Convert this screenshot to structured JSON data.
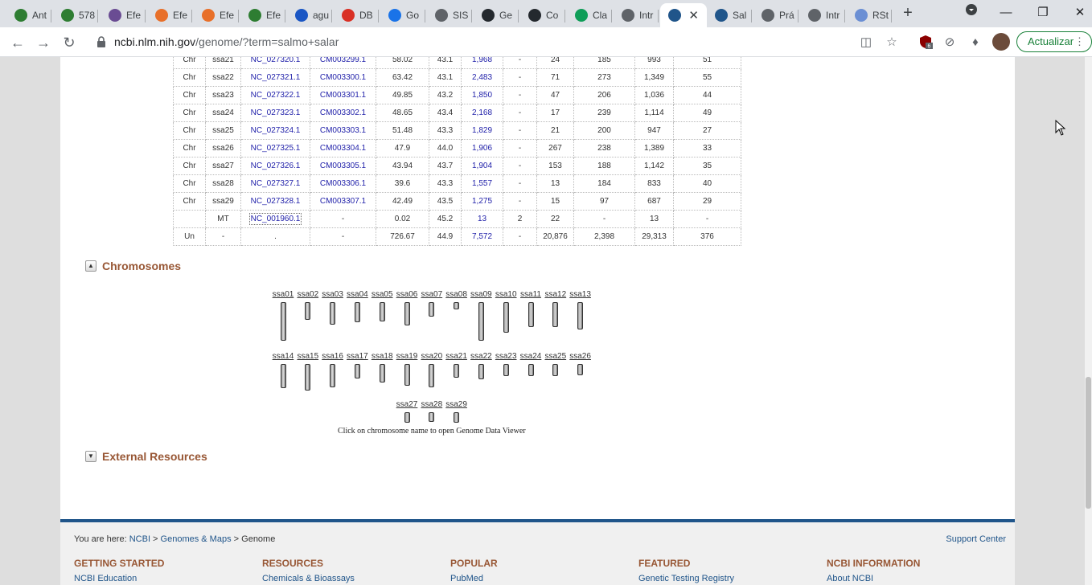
{
  "browser": {
    "tabs": [
      {
        "label": "Ant",
        "icon": "ncbi-icon",
        "color": "#2e7d32"
      },
      {
        "label": "578",
        "icon": "ncbi-icon",
        "color": "#2e7d32"
      },
      {
        "label": "Efe",
        "icon": "award-icon",
        "color": "#6a4c93"
      },
      {
        "label": "Efe",
        "icon": "elsevier-icon",
        "color": "#e8702a"
      },
      {
        "label": "Efe",
        "icon": "elsevier-icon",
        "color": "#e8702a"
      },
      {
        "label": "Efe",
        "icon": "ncbi-icon",
        "color": "#2e7d32"
      },
      {
        "label": "agu",
        "icon": "cap-icon",
        "color": "#1a56c4"
      },
      {
        "label": "DB",
        "icon": "gmail-icon",
        "color": "#d93025"
      },
      {
        "label": "Go",
        "icon": "calendar-icon",
        "color": "#1a73e8"
      },
      {
        "label": "SIS",
        "icon": "globe-icon",
        "color": "#5f6368"
      },
      {
        "label": "Ge",
        "icon": "github-icon",
        "color": "#24292e"
      },
      {
        "label": "Co",
        "icon": "github-icon",
        "color": "#24292e"
      },
      {
        "label": "Cla",
        "icon": "drive-icon",
        "color": "#0f9d58"
      },
      {
        "label": "Intr",
        "icon": "globe-icon",
        "color": "#5f6368"
      },
      {
        "label": "",
        "icon": "dna-icon",
        "color": "#20558a",
        "active": true
      },
      {
        "label": "Sal",
        "icon": "dna-icon",
        "color": "#20558a"
      },
      {
        "label": "Prá",
        "icon": "globe-icon",
        "color": "#5f6368"
      },
      {
        "label": "Intr",
        "icon": "globe-icon",
        "color": "#5f6368"
      },
      {
        "label": "RSt",
        "icon": "r-icon",
        "color": "#6b8fd4"
      }
    ],
    "url_host": "ncbi.nlm.nih.gov",
    "url_path": "/genome/?term=salmo+salar",
    "extension_badge": "6",
    "update_label": "Actualizar"
  },
  "assembly_table": {
    "rows": [
      [
        "Chr",
        "ssa21",
        "NC_027320.1",
        "CM003299.1",
        "58.02",
        "43.1",
        "1,968",
        "-",
        "24",
        "185",
        "993",
        "51"
      ],
      [
        "Chr",
        "ssa22",
        "NC_027321.1",
        "CM003300.1",
        "63.42",
        "43.1",
        "2,483",
        "-",
        "71",
        "273",
        "1,349",
        "55"
      ],
      [
        "Chr",
        "ssa23",
        "NC_027322.1",
        "CM003301.1",
        "49.85",
        "43.2",
        "1,850",
        "-",
        "47",
        "206",
        "1,036",
        "44"
      ],
      [
        "Chr",
        "ssa24",
        "NC_027323.1",
        "CM003302.1",
        "48.65",
        "43.4",
        "2,168",
        "-",
        "17",
        "239",
        "1,114",
        "49"
      ],
      [
        "Chr",
        "ssa25",
        "NC_027324.1",
        "CM003303.1",
        "51.48",
        "43.3",
        "1,829",
        "-",
        "21",
        "200",
        "947",
        "27"
      ],
      [
        "Chr",
        "ssa26",
        "NC_027325.1",
        "CM003304.1",
        "47.9",
        "44.0",
        "1,906",
        "-",
        "267",
        "238",
        "1,389",
        "33"
      ],
      [
        "Chr",
        "ssa27",
        "NC_027326.1",
        "CM003305.1",
        "43.94",
        "43.7",
        "1,904",
        "-",
        "153",
        "188",
        "1,142",
        "35"
      ],
      [
        "Chr",
        "ssa28",
        "NC_027327.1",
        "CM003306.1",
        "39.6",
        "43.3",
        "1,557",
        "-",
        "13",
        "184",
        "833",
        "40"
      ],
      [
        "Chr",
        "ssa29",
        "NC_027328.1",
        "CM003307.1",
        "42.49",
        "43.5",
        "1,275",
        "-",
        "15",
        "97",
        "687",
        "29"
      ],
      [
        "",
        "MT",
        "NC_001960.1",
        "-",
        "0.02",
        "45.2",
        "13",
        "2",
        "22",
        "-",
        "13",
        "-"
      ],
      [
        "Un",
        "-",
        ".",
        "-",
        "726.67",
        "44.9",
        "7,572",
        "-",
        "20,876",
        "2,398",
        "29,313",
        "376"
      ]
    ]
  },
  "chromosomes": {
    "title": "Chromosomes",
    "note": "Click on chromosome name to open Genome Data Viewer",
    "items": [
      {
        "name": "ssa01",
        "len": 159.04
      },
      {
        "name": "ssa02",
        "len": 72.94
      },
      {
        "name": "ssa03",
        "len": 92.05
      },
      {
        "name": "ssa04",
        "len": 82.74
      },
      {
        "name": "ssa05",
        "len": 80.09
      },
      {
        "name": "ssa06",
        "len": 96.08
      },
      {
        "name": "ssa07",
        "len": 61.44
      },
      {
        "name": "ssa08",
        "len": 28.4
      },
      {
        "name": "ssa09",
        "len": 160.83
      },
      {
        "name": "ssa10",
        "len": 125.88
      },
      {
        "name": "ssa11",
        "len": 102.44
      },
      {
        "name": "ssa12",
        "len": 103.22
      },
      {
        "name": "ssa13",
        "len": 113.4
      },
      {
        "name": "ssa14",
        "len": 101.0
      },
      {
        "name": "ssa15",
        "len": 110.46
      },
      {
        "name": "ssa16",
        "len": 96.17
      },
      {
        "name": "ssa17",
        "len": 58.54
      },
      {
        "name": "ssa18",
        "len": 75.38
      },
      {
        "name": "ssa19",
        "len": 90.45
      },
      {
        "name": "ssa20",
        "len": 96.39
      },
      {
        "name": "ssa21",
        "len": 58.02
      },
      {
        "name": "ssa22",
        "len": 63.42
      },
      {
        "name": "ssa23",
        "len": 49.85
      },
      {
        "name": "ssa24",
        "len": 48.65
      },
      {
        "name": "ssa25",
        "len": 51.48
      },
      {
        "name": "ssa26",
        "len": 47.9
      },
      {
        "name": "ssa27",
        "len": 43.94
      },
      {
        "name": "ssa28",
        "len": 39.6
      },
      {
        "name": "ssa29",
        "len": 42.49
      }
    ]
  },
  "external_resources": {
    "title": "External Resources"
  },
  "footer": {
    "you_are_here": "You are here:",
    "crumbs": [
      "NCBI",
      "Genomes & Maps",
      "Genome"
    ],
    "support": "Support Center",
    "columns": [
      {
        "heading": "GETTING STARTED",
        "link": "NCBI Education"
      },
      {
        "heading": "RESOURCES",
        "link": "Chemicals & Bioassays"
      },
      {
        "heading": "POPULAR",
        "link": "PubMed"
      },
      {
        "heading": "FEATURED",
        "link": "Genetic Testing Registry"
      },
      {
        "heading": "NCBI INFORMATION",
        "link": "About NCBI"
      }
    ]
  }
}
